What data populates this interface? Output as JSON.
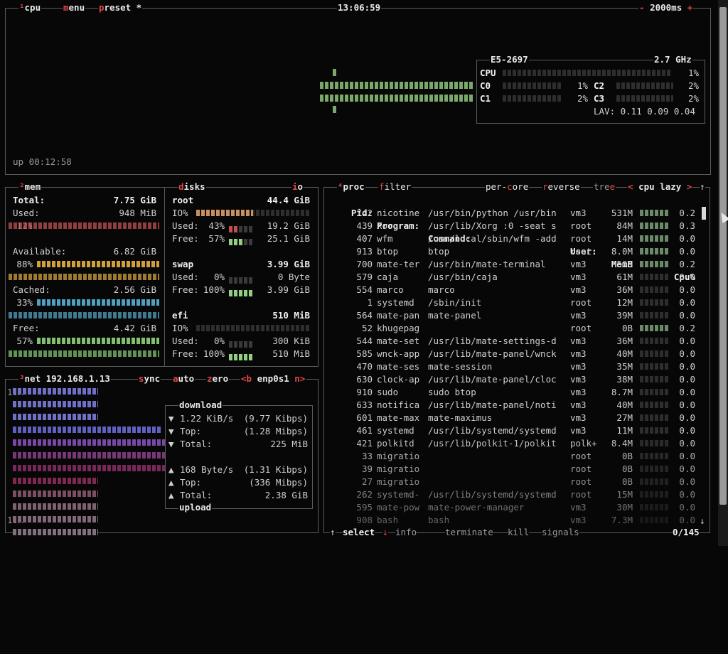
{
  "cpu_box": {
    "tabs": [
      {
        "hotkey": "¹",
        "label": "cpu"
      },
      {
        "hotkey": "m",
        "label": "enu"
      },
      {
        "hotkey": "p",
        "label": "reset *"
      }
    ],
    "clock": "13:06:59",
    "minus": "-",
    "interval": "2000ms",
    "plus": "+",
    "uptime": "up 00:12:58",
    "model": "E5-2697",
    "freq": "2.7 GHz",
    "total": {
      "label": "CPU",
      "pct": "1%",
      "value": 0.01
    },
    "cores": [
      {
        "label": "C0",
        "pct": "1%",
        "value": 0.01
      },
      {
        "label": "C1",
        "pct": "2%",
        "value": 0.02
      },
      {
        "label": "C2",
        "pct": "2%",
        "value": 0.02
      },
      {
        "label": "C3",
        "pct": "2%",
        "value": 0.02
      }
    ],
    "lav": "LAV: 0.11 0.09 0.04"
  },
  "mem_box": {
    "tag_hotkey": "²",
    "tag": "mem",
    "total_label": "Total:",
    "total_val": "7.75 GiB",
    "items": [
      {
        "label": "Used:",
        "val": "948 MiB",
        "pct": "12%",
        "value": 0.12,
        "color": "#c05050"
      },
      {
        "label": "Available:",
        "val": "6.82 GiB",
        "pct": "88%",
        "value": 0.88,
        "color": "#d0a040"
      },
      {
        "label": "Cached:",
        "val": "2.56 GiB",
        "pct": "33%",
        "value": 0.33,
        "color": "#50a0c0"
      },
      {
        "label": "Free:",
        "val": "4.42 GiB",
        "pct": "57%",
        "value": 0.57,
        "color": "#80c070"
      }
    ]
  },
  "disks_box": {
    "tag_hotkey": "d",
    "tag": "isks",
    "io_hotkey": "i",
    "io": "o",
    "disks": [
      {
        "name": "root",
        "size": "44.4 GiB",
        "io": "IO%",
        "io_val": 0.5,
        "used_label": "Used:",
        "used_pct": "43%",
        "used_val": "19.2 GiB",
        "used_frac": 0.43,
        "free_label": "Free:",
        "free_pct": "57%",
        "free_val": "25.1 GiB",
        "free_frac": 0.57
      },
      {
        "name": "swap",
        "size": "3.99 GiB",
        "io": "",
        "io_val": 0,
        "used_label": "Used:",
        "used_pct": "0%",
        "used_val": "0 Byte",
        "used_frac": 0,
        "free_label": "Free:",
        "free_pct": "100%",
        "free_val": "3.99 GiB",
        "free_frac": 1
      },
      {
        "name": "efi",
        "size": "510 MiB",
        "io": "IO%",
        "io_val": 0,
        "used_label": "Used:",
        "used_pct": "0%",
        "used_val": "300 KiB",
        "used_frac": 0,
        "free_label": "Free:",
        "free_pct": "100%",
        "free_val": "510 MiB",
        "free_frac": 1
      }
    ]
  },
  "net_box": {
    "tag_hotkey": "³",
    "tag": "net",
    "ip": "192.168.1.13",
    "sync_hotkey": "s",
    "sync": "ync",
    "auto_hotkey": "a",
    "auto": "uto",
    "zero_hotkey": "z",
    "zero": "ero",
    "iface_left": "<b",
    "iface": "enp0s1",
    "iface_right": "n>",
    "scale_top": "10K",
    "scale_bottom": "10K",
    "download_title": "download",
    "upload_title": "upload",
    "download": [
      {
        "arrow": "▼",
        "label": "1.22 KiB/s",
        "val": "(9.77 Kibps)"
      },
      {
        "arrow": "▼",
        "label": "Top:",
        "val": "(1.28 Mibps)"
      },
      {
        "arrow": "▼",
        "label": "Total:",
        "val": "225 MiB"
      }
    ],
    "upload": [
      {
        "arrow": "▲",
        "label": "168 Byte/s",
        "val": "(1.31 Kibps)"
      },
      {
        "arrow": "▲",
        "label": "Top:",
        "val": "(336 Mibps)"
      },
      {
        "arrow": "▲",
        "label": "Total:",
        "val": "2.38 GiB"
      }
    ]
  },
  "proc_box": {
    "tag_hotkey": "⁴",
    "tag": "proc",
    "filter_hotkey": "f",
    "filter": "ilter",
    "percore_a": "per-",
    "percore_hotkey": "c",
    "percore_b": "ore",
    "reverse_hotkey": "r",
    "reverse": "everse",
    "tree_a": "tre",
    "tree_hotkey": "e",
    "sort_left": "<",
    "sort": "cpu lazy",
    "sort_right": ">",
    "headers": {
      "pid": "Pid:",
      "program": "Program:",
      "command": "Command:",
      "user": "User:",
      "memb": "MemB",
      "cpu": "Cpu%"
    },
    "rows": [
      {
        "pid": "742",
        "program": "nicotine",
        "command": "/usr/bin/python /usr/bin",
        "user": "vm3",
        "memb": "531M",
        "cpu": "0.2"
      },
      {
        "pid": "439",
        "program": "Xorg",
        "command": "/usr/lib/Xorg :0 -seat s",
        "user": "root",
        "memb": "84M",
        "cpu": "0.3"
      },
      {
        "pid": "407",
        "program": "wfm",
        "command": "/usr/local/sbin/wfm -add",
        "user": "root",
        "memb": "14M",
        "cpu": "0.0"
      },
      {
        "pid": "913",
        "program": "btop",
        "command": "btop",
        "user": "root",
        "memb": "8.0M",
        "cpu": "0.0"
      },
      {
        "pid": "700",
        "program": "mate-ter",
        "command": "/usr/bin/mate-terminal",
        "user": "vm3",
        "memb": "50M",
        "cpu": "0.2"
      },
      {
        "pid": "579",
        "program": "caja",
        "command": "/usr/bin/caja",
        "user": "vm3",
        "memb": "61M",
        "cpu": "0.0"
      },
      {
        "pid": "554",
        "program": "marco",
        "command": "marco",
        "user": "vm3",
        "memb": "36M",
        "cpu": "0.0"
      },
      {
        "pid": "1",
        "program": "systemd",
        "command": "/sbin/init",
        "user": "root",
        "memb": "12M",
        "cpu": "0.0"
      },
      {
        "pid": "564",
        "program": "mate-pan",
        "command": "mate-panel",
        "user": "vm3",
        "memb": "39M",
        "cpu": "0.0"
      },
      {
        "pid": "52",
        "program": "khugepag",
        "command": "",
        "user": "root",
        "memb": "0B",
        "cpu": "0.2"
      },
      {
        "pid": "544",
        "program": "mate-set",
        "command": "/usr/lib/mate-settings-d",
        "user": "vm3",
        "memb": "36M",
        "cpu": "0.0"
      },
      {
        "pid": "585",
        "program": "wnck-app",
        "command": "/usr/lib/mate-panel/wnck",
        "user": "vm3",
        "memb": "40M",
        "cpu": "0.0"
      },
      {
        "pid": "470",
        "program": "mate-ses",
        "command": "mate-session",
        "user": "vm3",
        "memb": "35M",
        "cpu": "0.0"
      },
      {
        "pid": "630",
        "program": "clock-ap",
        "command": "/usr/lib/mate-panel/cloc",
        "user": "vm3",
        "memb": "38M",
        "cpu": "0.0"
      },
      {
        "pid": "910",
        "program": "sudo",
        "command": "sudo btop",
        "user": "vm3",
        "memb": "8.7M",
        "cpu": "0.0"
      },
      {
        "pid": "633",
        "program": "notifica",
        "command": "/usr/lib/mate-panel/noti",
        "user": "vm3",
        "memb": "40M",
        "cpu": "0.0"
      },
      {
        "pid": "601",
        "program": "mate-max",
        "command": "mate-maximus",
        "user": "vm3",
        "memb": "27M",
        "cpu": "0.0"
      },
      {
        "pid": "461",
        "program": "systemd",
        "command": "/usr/lib/systemd/systemd",
        "user": "vm3",
        "memb": "11M",
        "cpu": "0.0"
      },
      {
        "pid": "421",
        "program": "polkitd",
        "command": "/usr/lib/polkit-1/polkit",
        "user": "polk+",
        "memb": "8.4M",
        "cpu": "0.0"
      },
      {
        "pid": "33",
        "program": "migratio",
        "command": "",
        "user": "root",
        "memb": "0B",
        "cpu": "0.0"
      },
      {
        "pid": "39",
        "program": "migratio",
        "command": "",
        "user": "root",
        "memb": "0B",
        "cpu": "0.0"
      },
      {
        "pid": "27",
        "program": "migratio",
        "command": "",
        "user": "root",
        "memb": "0B",
        "cpu": "0.0"
      },
      {
        "pid": "262",
        "program": "systemd-",
        "command": "/usr/lib/systemd/systemd",
        "user": "root",
        "memb": "15M",
        "cpu": "0.0"
      },
      {
        "pid": "595",
        "program": "mate-pow",
        "command": "mate-power-manager",
        "user": "vm3",
        "memb": "30M",
        "cpu": "0.0"
      },
      {
        "pid": "908",
        "program": "bash",
        "command": "bash",
        "user": "vm3",
        "memb": "7.3M",
        "cpu": "0.0"
      }
    ],
    "footer": {
      "up": "↑",
      "select": "select",
      "down": "↓",
      "info": "info",
      "terminate": "terminate",
      "kill": "kill",
      "signals": "signals",
      "count": "0/145"
    }
  }
}
